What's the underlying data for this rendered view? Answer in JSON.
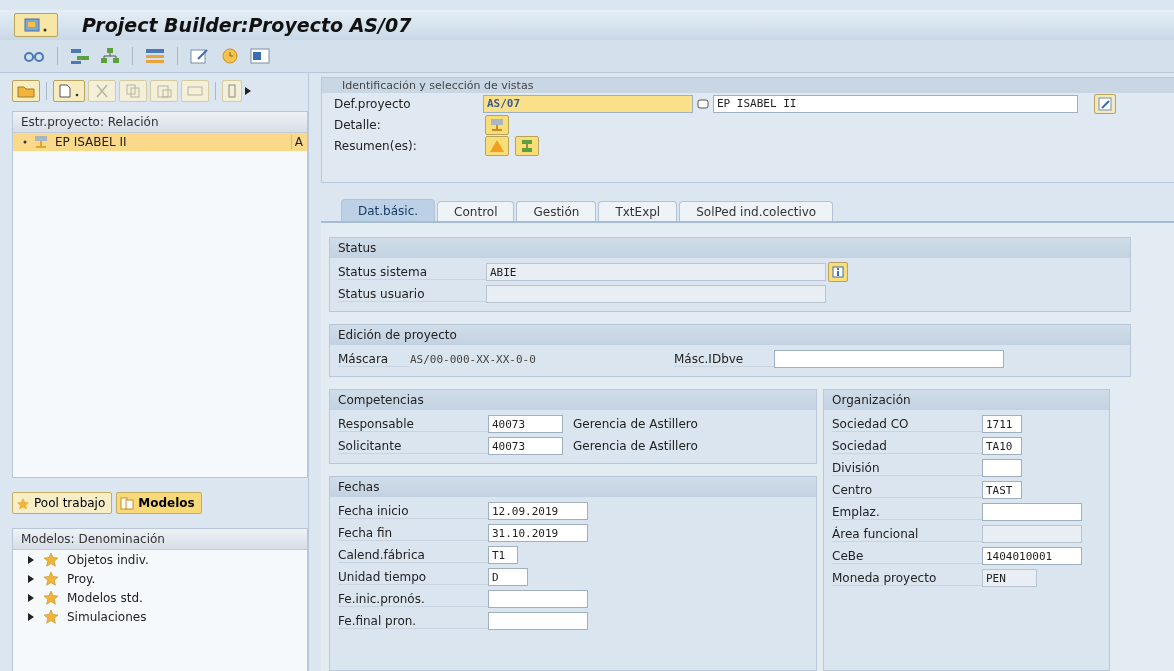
{
  "window": {
    "title": "Project Builder:Proyecto AS/07"
  },
  "left_pane": {
    "structure_header": "Estr.proyecto: Relación",
    "structure_tree": [
      {
        "label": "EP ISABEL II",
        "column_2": "A",
        "selected": true
      }
    ],
    "buttons": [
      {
        "label": "Pool trabajo",
        "selected": false
      },
      {
        "label": "Modelos",
        "selected": true
      }
    ],
    "models_header": "Modelos: Denominación",
    "models_tree": [
      {
        "label": "Objetos indiv.",
        "expanded": false
      },
      {
        "label": "Proy.",
        "expanded": false
      },
      {
        "label": "Modelos std.",
        "expanded": false
      },
      {
        "label": "Simulaciones",
        "expanded": false
      }
    ]
  },
  "identification": {
    "title": "Identificación y selección de vistas",
    "project_label": "Def.proyecto",
    "project_value": "AS/07",
    "project_description": "EP ISABEL II",
    "detail_label": "Detalle:",
    "summary_label": "Resumen(es):"
  },
  "tabs": [
    {
      "label": "Dat.básic.",
      "selected": true
    },
    {
      "label": "Control",
      "selected": false
    },
    {
      "label": "Gestión",
      "selected": false
    },
    {
      "label": "TxtExpl",
      "selected": false
    },
    {
      "label": "SolPed ind.colectivo",
      "selected": false
    }
  ],
  "status": {
    "title": "Status",
    "fields": [
      {
        "label": "Status sistema",
        "value": "ABIE",
        "disabled": true
      },
      {
        "label": "Status usuario",
        "disabled": true
      }
    ]
  },
  "project_edit": {
    "title": "Edición de proyecto",
    "mask_label": "Máscara",
    "mask_value": "AS/00-000-XX-XX-0-0",
    "id_label": "Másc.IDbve"
  },
  "competencies": {
    "title": "Competencias",
    "rows": [
      {
        "label": "Responsable",
        "value": "40073",
        "description": "Gerencia de Astillero"
      },
      {
        "label": "Solicitante",
        "value": "40073",
        "description": "Gerencia de Astillero"
      }
    ]
  },
  "dates": {
    "title": "Fechas",
    "fields": [
      {
        "label": "Fecha inicio",
        "value": "12.09.2019",
        "disabled": false
      },
      {
        "label": "Fecha fin",
        "value": "31.10.2019",
        "disabled": false
      },
      {
        "label": "Calend.fábrica",
        "value": "T1",
        "disabled": false
      },
      {
        "label": "Unidad tiempo",
        "value": "D",
        "disabled": false
      },
      {
        "label": "Fe.inic.pronós.",
        "disabled": false
      },
      {
        "label": "Fe.final pron.",
        "disabled": false
      }
    ]
  },
  "organization": {
    "title": "Organización",
    "fields": [
      {
        "label": "Sociedad CO",
        "value": "1711",
        "disabled": false
      },
      {
        "label": "Sociedad",
        "value": "TA10",
        "disabled": false
      },
      {
        "label": "División",
        "disabled": false
      },
      {
        "label": "Centro",
        "value": "TAST",
        "disabled": false
      },
      {
        "label": "Emplaz.",
        "disabled": false
      },
      {
        "label": "Área funcional",
        "disabled": true
      },
      {
        "label": "CeBe",
        "value": "1404010001",
        "disabled": false
      },
      {
        "label": "Moneda proyecto",
        "value": "PEN",
        "disabled": true
      }
    ]
  }
}
